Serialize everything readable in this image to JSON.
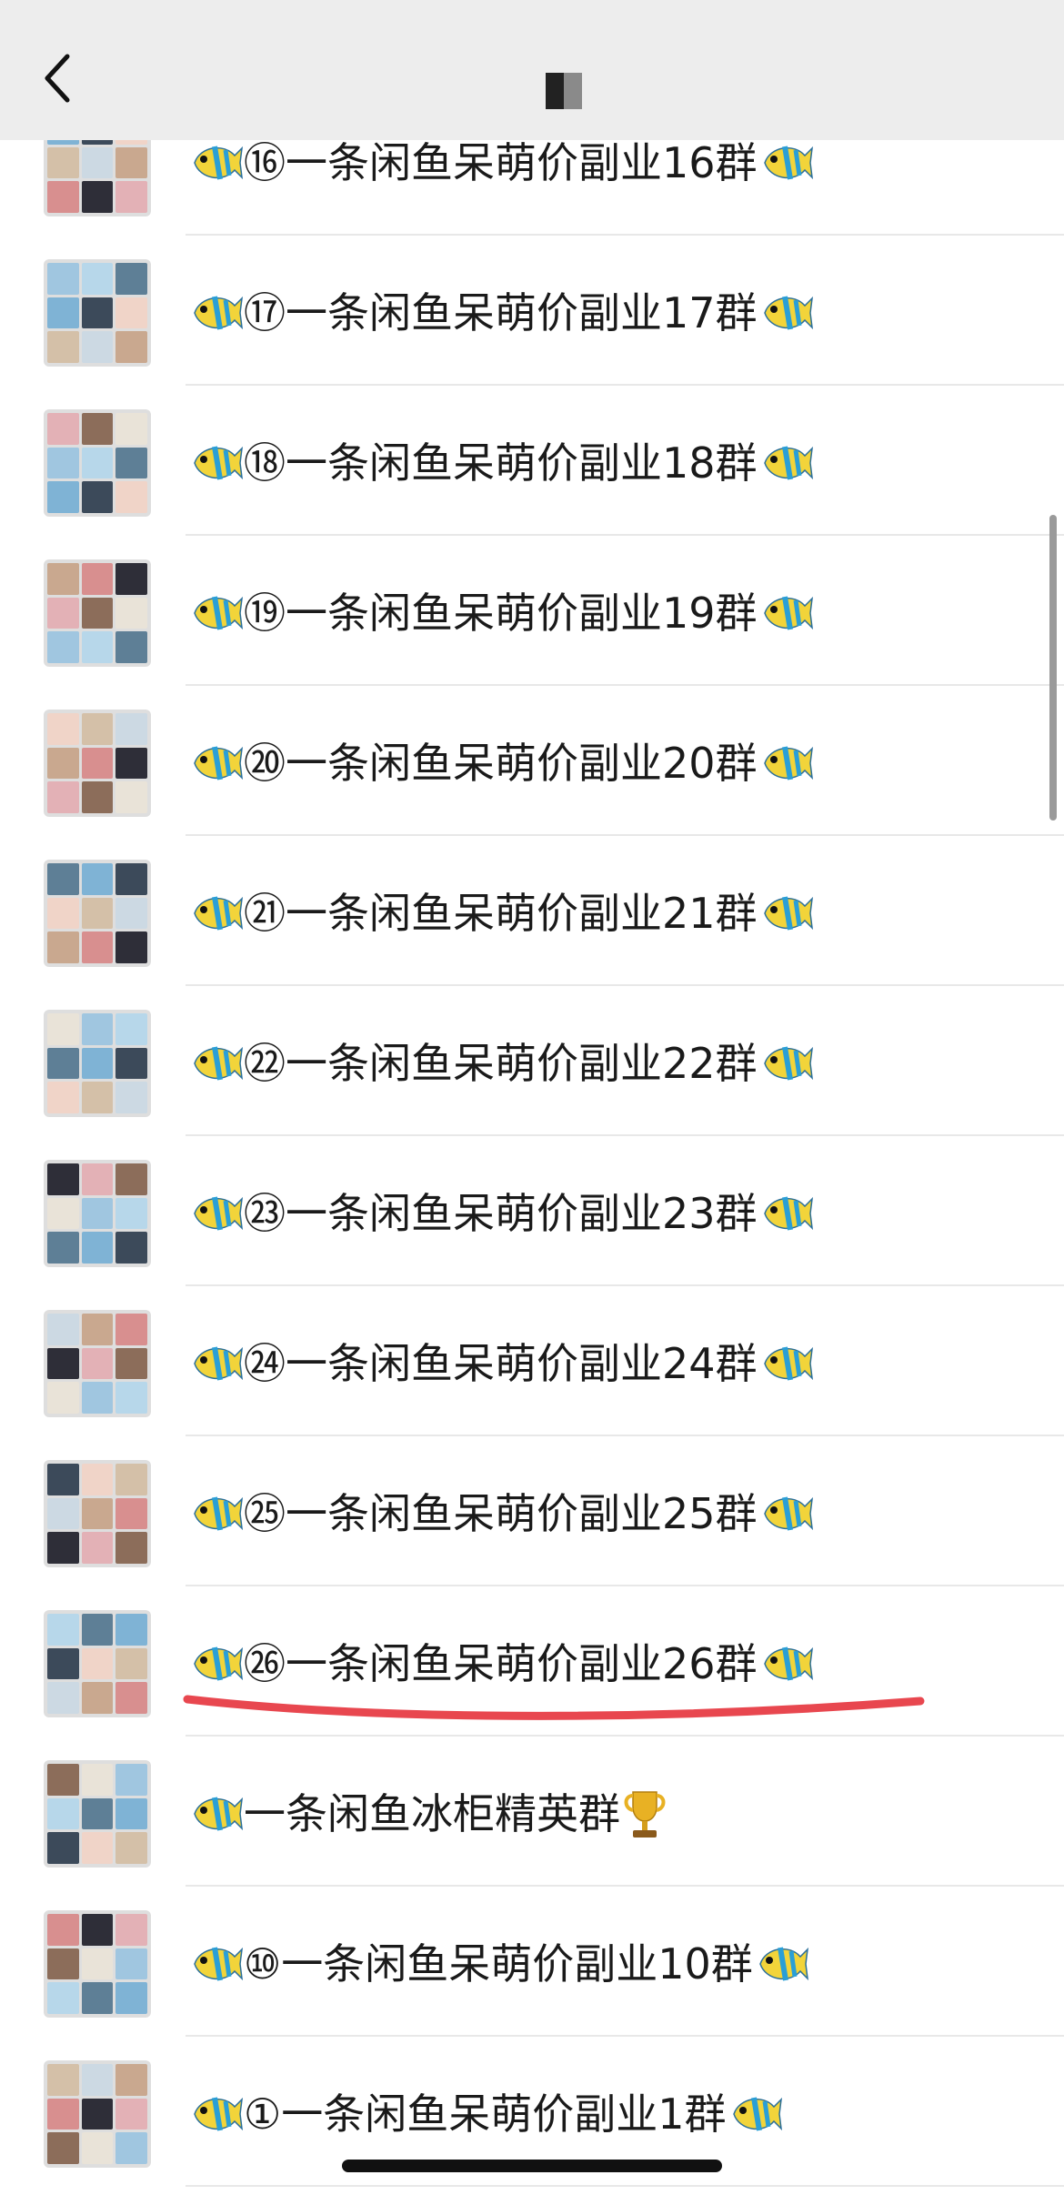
{
  "nav": {
    "back_icon": "chevron-left-icon"
  },
  "groups": [
    {
      "prefix": "⑯",
      "name": "一条闲鱼呆萌价副业16群",
      "leading_icon": "fish-icon",
      "trailing_icon": "fish-icon"
    },
    {
      "prefix": "⑰",
      "name": "一条闲鱼呆萌价副业17群",
      "leading_icon": "fish-icon",
      "trailing_icon": "fish-icon"
    },
    {
      "prefix": "⑱",
      "name": "一条闲鱼呆萌价副业18群",
      "leading_icon": "fish-icon",
      "trailing_icon": "fish-icon"
    },
    {
      "prefix": "⑲",
      "name": "一条闲鱼呆萌价副业19群",
      "leading_icon": "fish-icon",
      "trailing_icon": "fish-icon"
    },
    {
      "prefix": "⑳",
      "name": "一条闲鱼呆萌价副业20群",
      "leading_icon": "fish-icon",
      "trailing_icon": "fish-icon"
    },
    {
      "prefix": "㉑",
      "name": "一条闲鱼呆萌价副业21群",
      "leading_icon": "fish-icon",
      "trailing_icon": "fish-icon"
    },
    {
      "prefix": "㉒",
      "name": "一条闲鱼呆萌价副业22群",
      "leading_icon": "fish-icon",
      "trailing_icon": "fish-icon"
    },
    {
      "prefix": "㉓",
      "name": "一条闲鱼呆萌价副业23群",
      "leading_icon": "fish-icon",
      "trailing_icon": "fish-icon"
    },
    {
      "prefix": "㉔",
      "name": "一条闲鱼呆萌价副业24群",
      "leading_icon": "fish-icon",
      "trailing_icon": "fish-icon"
    },
    {
      "prefix": "㉕",
      "name": "一条闲鱼呆萌价副业25群",
      "leading_icon": "fish-icon",
      "trailing_icon": "fish-icon"
    },
    {
      "prefix": "㉖",
      "name": "一条闲鱼呆萌价副业26群",
      "leading_icon": "fish-icon",
      "trailing_icon": "fish-icon",
      "highlighted": true
    },
    {
      "prefix": "",
      "name": "一条闲鱼冰柜精英群",
      "leading_icon": "fish-icon",
      "trailing_icon": "trophy-icon"
    },
    {
      "prefix": "⑩",
      "name": "一条闲鱼呆萌价副业10群",
      "leading_icon": "fish-icon",
      "trailing_icon": "fish-icon"
    },
    {
      "prefix": "①",
      "name": "一条闲鱼呆萌价副业1群",
      "leading_icon": "fish-icon",
      "trailing_icon": "fish-icon"
    }
  ],
  "colors": {
    "nav_background": "#ededed",
    "annotation_underline": "#e8474f",
    "fish_body": "#f2d43a",
    "fish_stripe": "#2a9fd6"
  }
}
